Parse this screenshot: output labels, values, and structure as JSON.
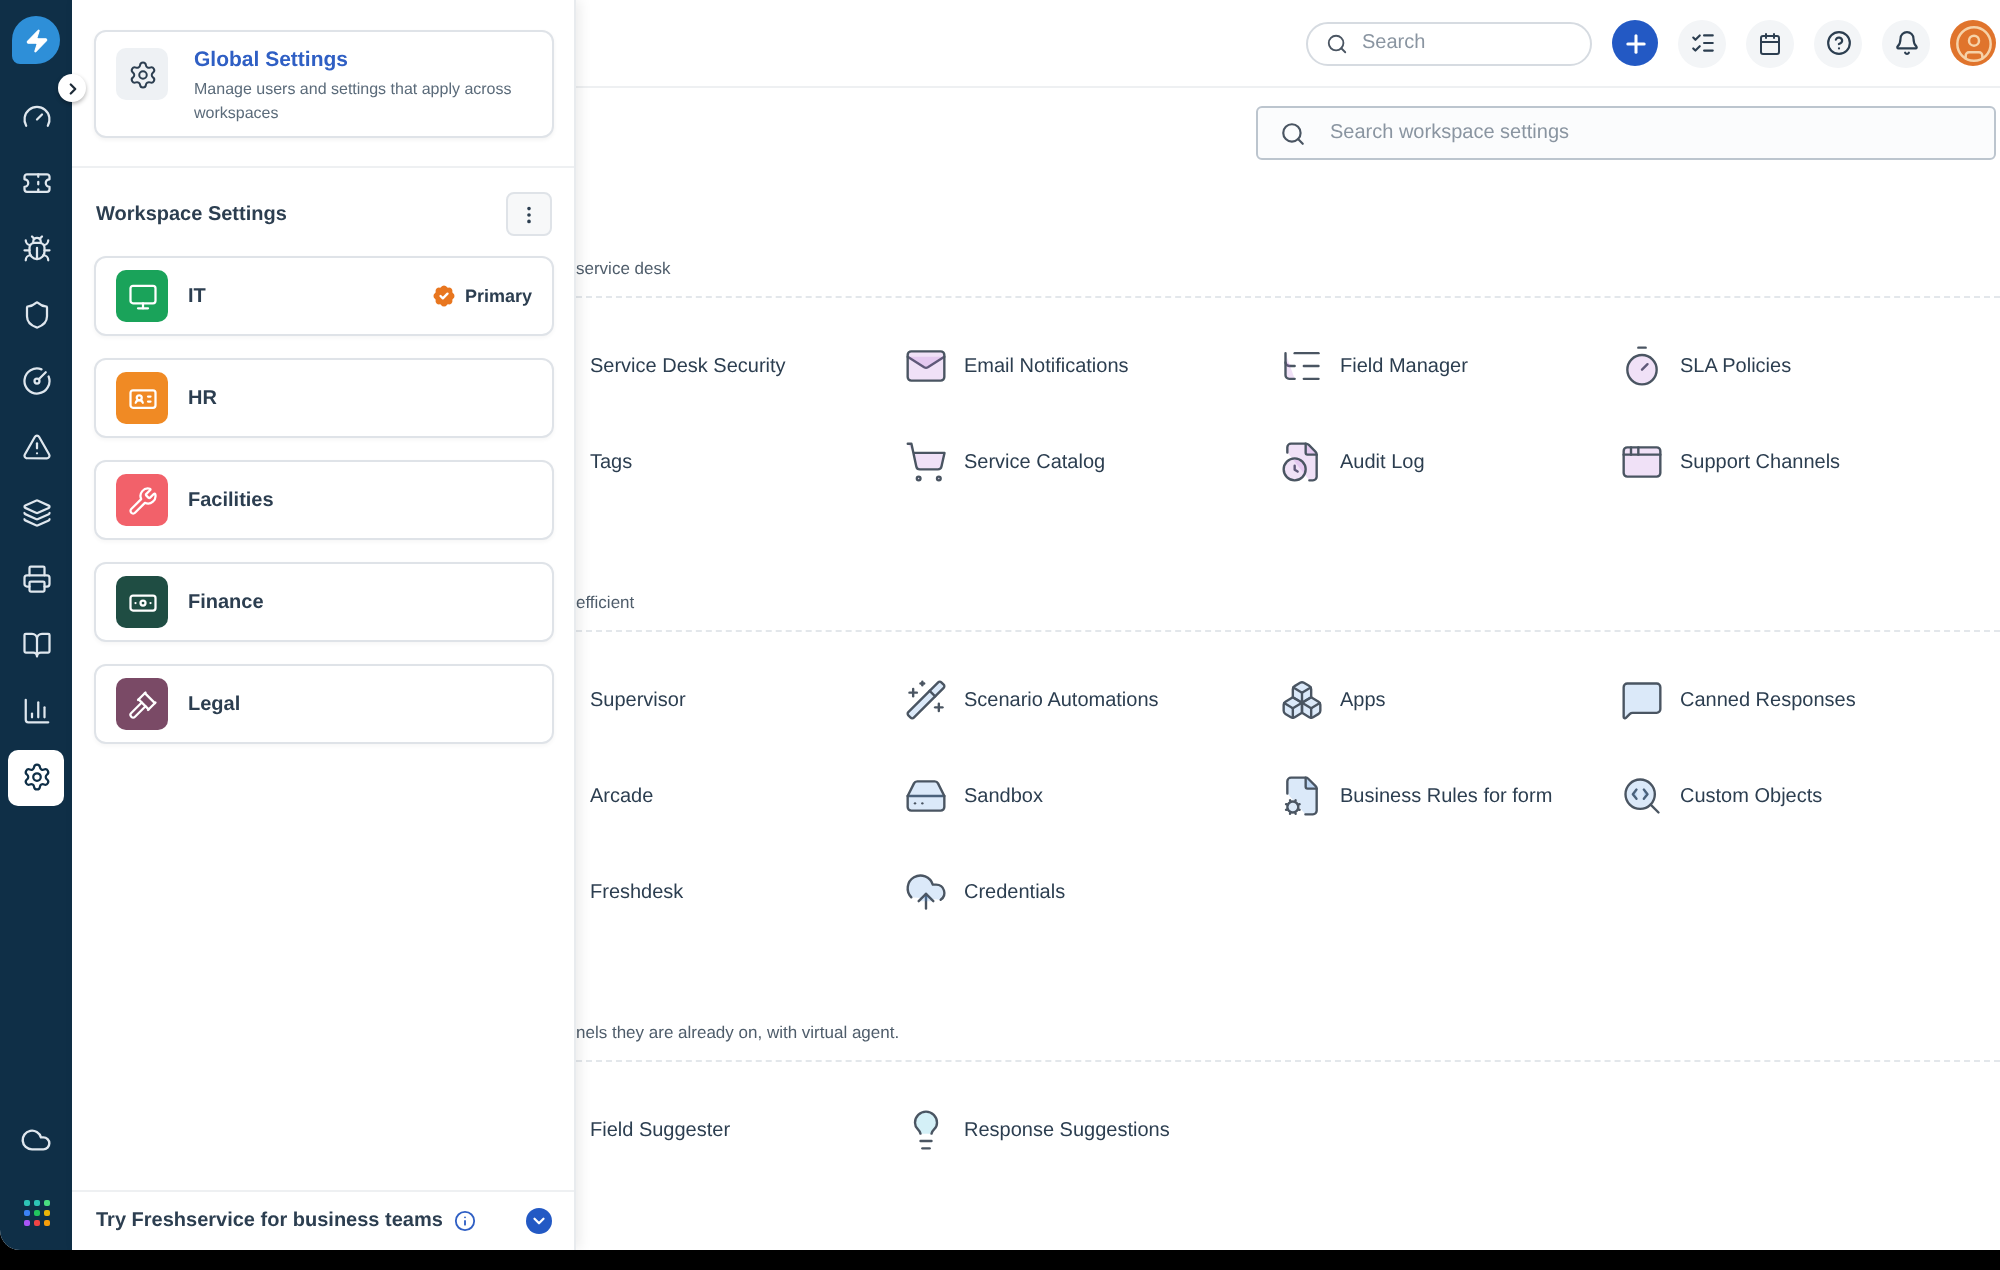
{
  "rail": [
    {
      "selected": false
    },
    {
      "selected": false
    },
    {
      "selected": false
    },
    {
      "selected": false
    },
    {
      "selected": false
    },
    {
      "selected": false
    },
    {
      "selected": false
    },
    {
      "selected": false
    },
    {
      "selected": false
    },
    {
      "selected": false
    },
    {
      "selected": true
    }
  ],
  "panel": {
    "global": {
      "title": "Global Settings",
      "description": "Manage users and settings that apply across workspaces"
    },
    "workspace_title": "Workspace Settings",
    "workspaces": [
      {
        "name": "IT",
        "color": "#1aa35a",
        "badge": "Primary"
      },
      {
        "name": "HR",
        "color": "#f08a24"
      },
      {
        "name": "Facilities",
        "color": "#f2616a"
      },
      {
        "name": "Finance",
        "color": "#1f4d43"
      },
      {
        "name": "Legal",
        "color": "#7a4a66"
      }
    ],
    "footer": "Try Freshservice for business teams"
  },
  "topbar": {
    "search": {
      "placeholder": "Search"
    }
  },
  "settings_search": {
    "placeholder": "Search workspace settings"
  },
  "sections": [
    {
      "description": "service desk",
      "items": [
        {
          "label": "Service Desk Security"
        },
        {
          "label": "Email Notifications"
        },
        {
          "label": "Field Manager"
        },
        {
          "label": "SLA Policies"
        },
        {
          "label": "Tags"
        },
        {
          "label": "Service Catalog"
        },
        {
          "label": "Audit Log"
        },
        {
          "label": "Support Channels"
        }
      ]
    },
    {
      "description": "efficient",
      "items": [
        {
          "label": "Supervisor"
        },
        {
          "label": "Scenario Automations"
        },
        {
          "label": "Apps"
        },
        {
          "label": "Canned Responses"
        },
        {
          "label": "Arcade"
        },
        {
          "label": "Sandbox"
        },
        {
          "label": "Business Rules for form"
        },
        {
          "label": "Custom Objects"
        },
        {
          "label": "Freshdesk"
        },
        {
          "label": "Credentials"
        }
      ]
    },
    {
      "description": "nels they are already on, with virtual agent.",
      "items": [
        {
          "label": "Field Suggester"
        },
        {
          "label": "Response Suggestions"
        }
      ]
    }
  ]
}
